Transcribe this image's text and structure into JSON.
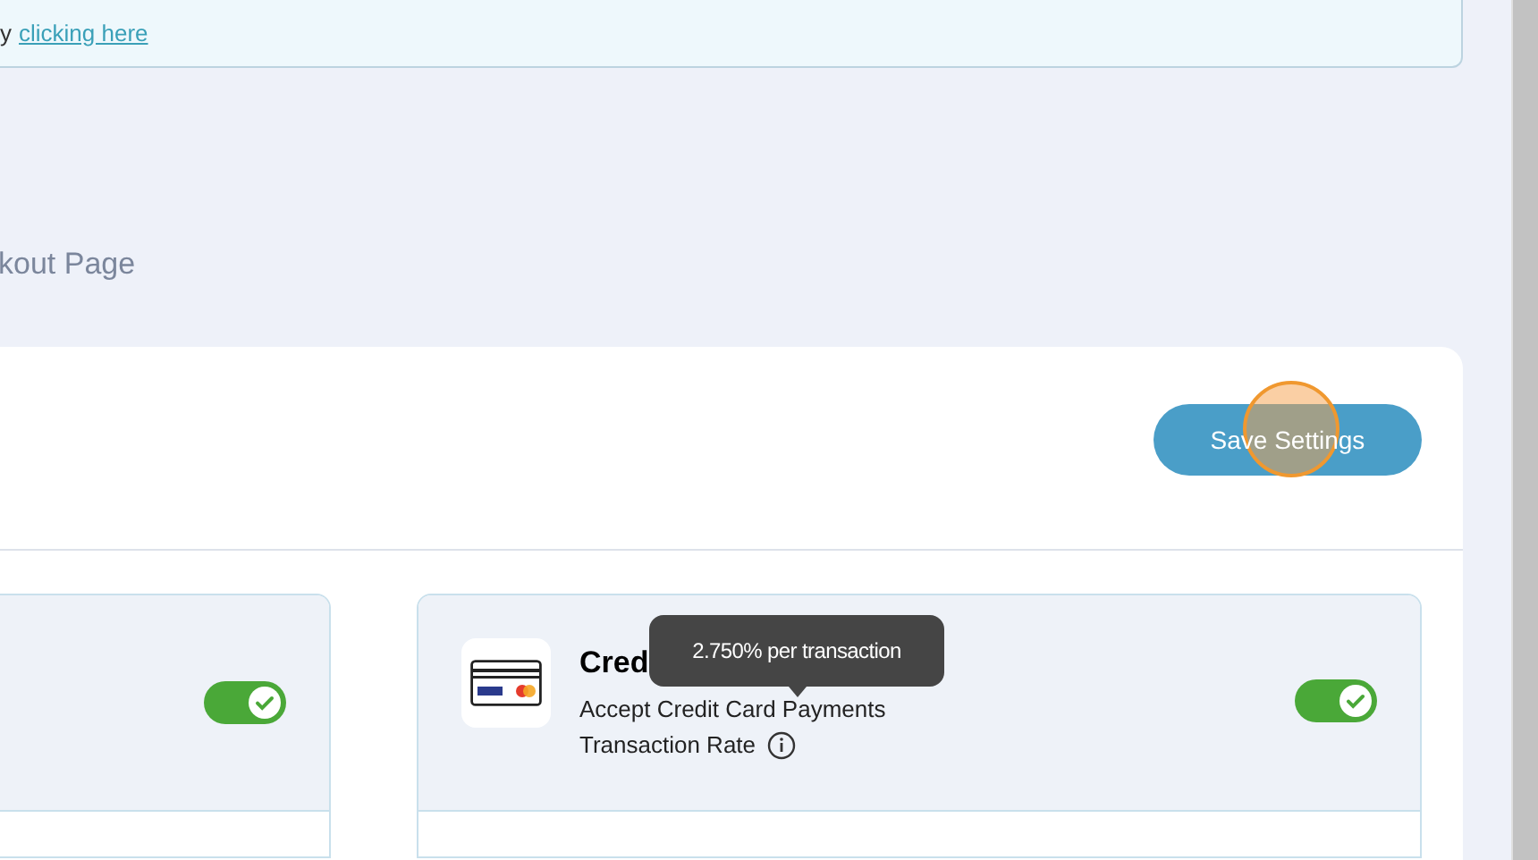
{
  "banner": {
    "text": "y",
    "link": "clicking here"
  },
  "heading": "kout Page",
  "save_button": {
    "label": "Save Settings"
  },
  "cards": [
    {
      "kind": "cut",
      "on": true
    },
    {
      "kind": "full",
      "title": "Cred",
      "subtitle": "Accept Credit Card Payments",
      "rate_label": "Transaction Rate",
      "on": true,
      "tooltip": "2.750% per transaction"
    }
  ]
}
